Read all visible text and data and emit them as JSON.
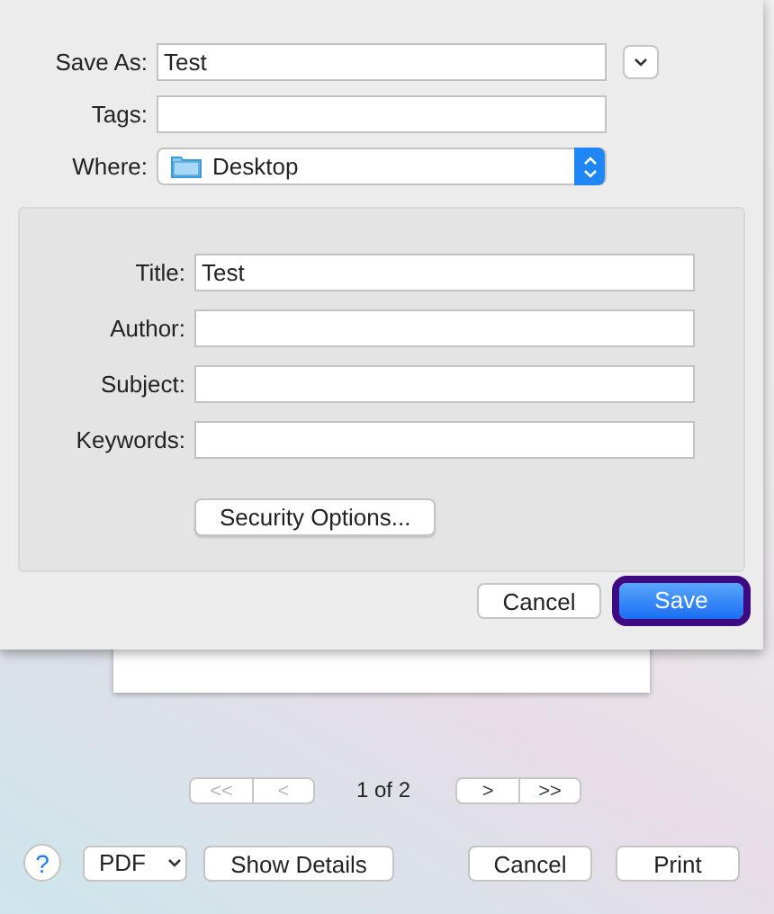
{
  "sheet": {
    "save_as": {
      "label": "Save As:",
      "value": "Test"
    },
    "tags": {
      "label": "Tags:"
    },
    "where": {
      "label": "Where:",
      "value": "Desktop"
    },
    "metadata": [
      {
        "label": "Title:",
        "value": "Test"
      },
      {
        "label": "Author:"
      },
      {
        "label": "Subject:"
      },
      {
        "label": "Keywords:"
      }
    ],
    "security_button": "Security Options...",
    "buttons": [
      {
        "label": "Cancel",
        "kind": "plain",
        "focused": false
      },
      {
        "label": "Save",
        "kind": "default",
        "focused": true
      }
    ]
  },
  "pager": {
    "buttons": [
      {
        "label": "<<",
        "disabled": true
      },
      {
        "label": "<",
        "disabled": true
      }
    ],
    "page": "1 of 2",
    "next_buttons": [
      {
        "label": ">",
        "disabled": false
      },
      {
        "label": ">>",
        "disabled": false
      }
    ]
  },
  "bottom_bar": {
    "help": "?",
    "pdf": "PDF",
    "details": "Show Details",
    "cancel": "Cancel",
    "print": "Print"
  }
}
